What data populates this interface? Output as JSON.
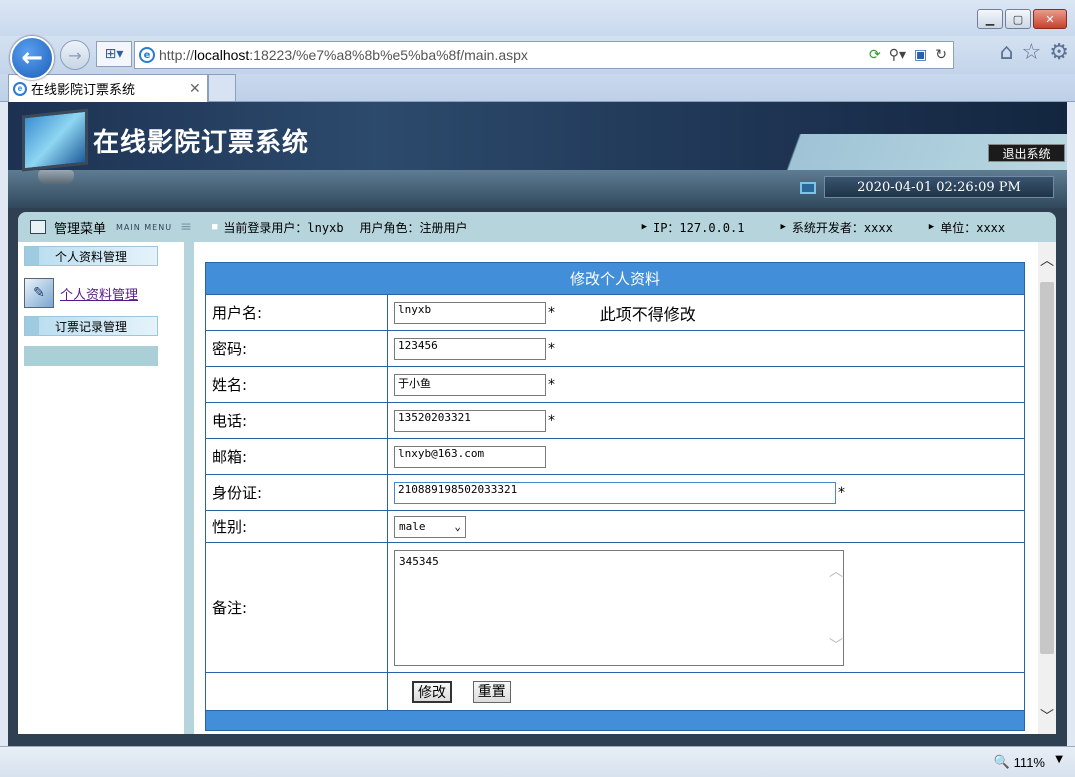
{
  "browser": {
    "url_prefix": "http://",
    "url_host": "localhost",
    "url_rest": ":18223/%e7%a8%8b%e5%ba%8f/main.aspx",
    "tab_title": "在线影院订票系统",
    "zoom": "111%"
  },
  "header": {
    "site_title": "在线影院订票系统",
    "logout_label": "退出系统",
    "datetime": "2020-04-01 02:26:09 PM"
  },
  "menu_header": {
    "label": "管理菜单",
    "label_en": "MAIN MENU"
  },
  "info_bar": {
    "current_user": "当前登录用户：lnyxb",
    "role": "用户角色：注册用户",
    "ip": "IP：127.0.0.1",
    "developer": "系统开发者：xxxx",
    "unit": "单位：xxxx"
  },
  "sidebar": {
    "section1": "个人资料管理",
    "link1": "个人资料管理",
    "section2": "订票记录管理"
  },
  "form": {
    "caption": "修改个人资料",
    "username_label": "用户名:",
    "username_value": "lnyxb",
    "username_note": "此项不得修改",
    "password_label": "密码:",
    "password_value": "123456",
    "name_label": "姓名:",
    "name_value": "于小鱼",
    "phone_label": "电话:",
    "phone_value": "13520203321",
    "email_label": "邮箱:",
    "email_value": "lnxyb@163.com",
    "idcard_label": "身份证:",
    "idcard_value": "210889198502033321",
    "gender_label": "性别:",
    "gender_value": "male",
    "remark_label": "备注:",
    "remark_value": "345345",
    "submit_label": "修改",
    "reset_label": "重置",
    "required_mark": "*"
  }
}
